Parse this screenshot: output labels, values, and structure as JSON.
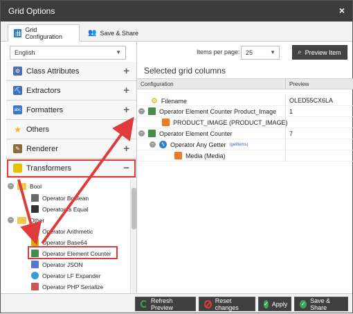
{
  "window": {
    "title": "Grid Options",
    "close": "×"
  },
  "tabs": [
    {
      "label": "Grid Configuration",
      "active": true
    },
    {
      "label": "Save & Share",
      "active": false
    }
  ],
  "language": {
    "value": "English"
  },
  "items_per_page": {
    "label": "Items per page:",
    "value": "25"
  },
  "preview_item": {
    "label": "Preview Item"
  },
  "accordion": [
    {
      "label": "Class Attributes",
      "state": "+"
    },
    {
      "label": "Extractors",
      "state": "+"
    },
    {
      "label": "Formatters",
      "state": "+"
    },
    {
      "label": "Others",
      "state": "+"
    },
    {
      "label": "Renderer",
      "state": "+"
    },
    {
      "label": "Transformers",
      "state": "−"
    }
  ],
  "tree": [
    {
      "label": "Bool",
      "type": "folder"
    },
    {
      "label": "Operator Boolean",
      "type": "item"
    },
    {
      "label": "Operator Is Equal",
      "type": "item"
    },
    {
      "label": "Other",
      "type": "folder"
    },
    {
      "label": "Operator Arithmetic",
      "type": "item"
    },
    {
      "label": "Operator Base64",
      "type": "item"
    },
    {
      "label": "Operator Element Counter",
      "type": "item",
      "highlighted": true
    },
    {
      "label": "Operator JSON",
      "type": "item"
    },
    {
      "label": "Operator LF Expander",
      "type": "item"
    },
    {
      "label": "Operator PHP Serialize",
      "type": "item"
    }
  ],
  "selected_columns": {
    "title": "Selected grid columns",
    "headers": {
      "configuration": "Configuration",
      "preview": "Preview"
    },
    "rows": [
      {
        "label": "Filename",
        "preview": "OLED55CX6LA",
        "level": 0
      },
      {
        "label": "Operator Element Counter Product_Image",
        "preview": "1",
        "level": 0
      },
      {
        "label": "PRODUCT_IMAGE (PRODUCT_IMAGE)",
        "preview": "",
        "level": 1
      },
      {
        "label": "Operator Element Counter",
        "preview": "7",
        "level": 0
      },
      {
        "label": "Operator Any Getter",
        "sub": "(getItems)",
        "preview": "",
        "level": 1
      },
      {
        "label": "Media (Media)",
        "preview": "",
        "level": 2
      }
    ]
  },
  "footer": {
    "refresh": "Refresh Preview",
    "reset": "Reset changes",
    "apply": "Apply",
    "save_share": "Save & Share"
  },
  "colors": {
    "highlight": "#e03b3b",
    "titlebar": "#3c3c3c",
    "accent": "#2d7dd2"
  }
}
